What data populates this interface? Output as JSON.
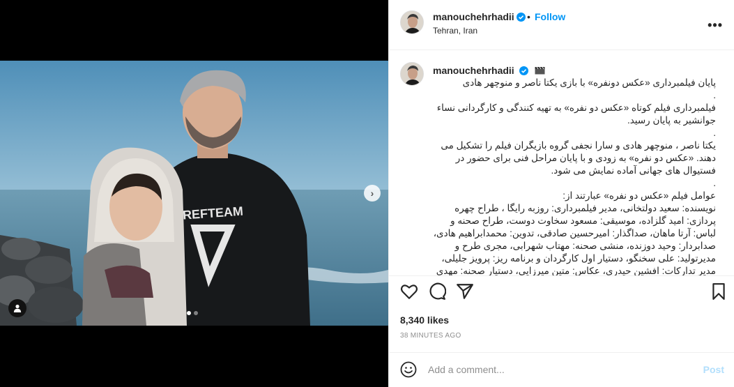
{
  "post": {
    "media": {
      "next_icon": "chevron-right-icon",
      "tag_icon": "user-tag-icon",
      "carousel_count": 2,
      "carousel_active": 1
    },
    "header": {
      "username": "manouchehrhadii",
      "separator": "•",
      "follow_label": "Follow",
      "location": "Tehran, Iran",
      "more_label": "•••"
    },
    "caption": {
      "username": "manouchehrhadii",
      "text": "پایان فیلمبرداری «عکس دونفره» با بازی یکتا ناصر و منوچهر هادی\n.\nفیلمبرداری فیلم کوتاه «عکس دو نفره» به تهیه کنندگی و کارگردانی نساء جوانشیر به پایان رسید.\n.\nیکتا ناصر ، منوچهر هادی و سارا نجفی گروه بازیگران فیلم را تشکیل می دهند. «عکس دو نفره» به زودی و با پایان مراحل فنی برای حضور در فستیوال های جهانی آماده نمایش می شود.\n.\nعوامل فیلم «عکس دو نفره» عبارتند از:\nنویسنده: سعید دولتخانی، مدیر فیلمبرداری: روزبه رایگا ، طراح چهره پردازی: امید گلزاده، موسیقی: مسعود سخاوت دوست، طراح صحنه و لباس: آرتا ماهان، صداگذار: امیرحسین صادقی، تدوین: محمدابراهیم هادی، صدابردار: وحید دوزنده، منشی صحنه: مهتاب شهرابی، مجری طرح و مدیرتولید: علی سخنگو، دستیار اول کارگردان و برنامه ریز: پرویز جلیلی، مدیر تدارکات: افشین حیدری، عکاس: متین میرزایی، دستیار صحنه: مهدی کرمی"
    },
    "actions": {
      "like_icon": "heart-icon",
      "comment_icon": "comment-icon",
      "share_icon": "share-icon",
      "save_icon": "bookmark-icon"
    },
    "likes": "8,340 likes",
    "time": "38 MINUTES AGO",
    "comment": {
      "emoji_icon": "emoji-icon",
      "placeholder": "Add a comment...",
      "post_label": "Post"
    }
  },
  "colors": {
    "link_blue": "#0095f6",
    "post_disabled": "#b2dffc",
    "border": "#efefef",
    "muted": "#8e8e8e"
  }
}
